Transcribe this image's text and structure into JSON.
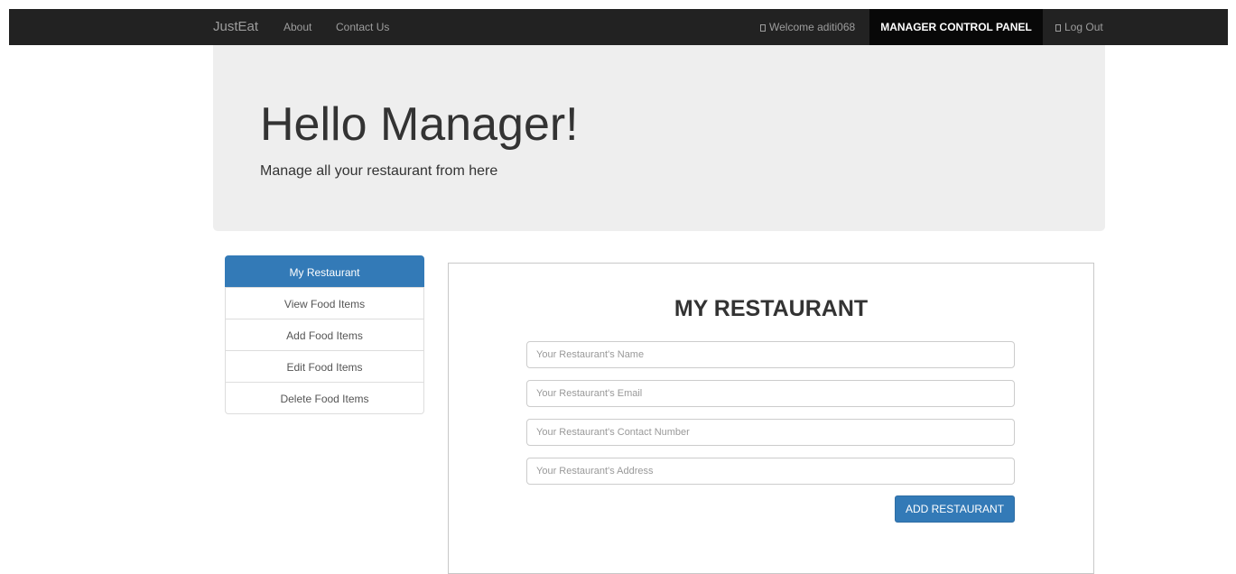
{
  "navbar": {
    "brand": "JustEat",
    "links": {
      "about": "About",
      "contact": "Contact Us"
    },
    "welcome": "Welcome aditi068",
    "control_panel": "MANAGER CONTROL PANEL",
    "logout": "Log Out"
  },
  "jumbotron": {
    "title": "Hello Manager!",
    "subtitle": "Manage all your restaurant from here"
  },
  "sidebar": {
    "items": [
      {
        "label": "My Restaurant",
        "active": true
      },
      {
        "label": "View Food Items"
      },
      {
        "label": "Add Food Items"
      },
      {
        "label": "Edit Food Items"
      },
      {
        "label": "Delete Food Items"
      }
    ]
  },
  "panel": {
    "title": "MY RESTAURANT",
    "fields": {
      "name": {
        "placeholder": "Your Restaurant's Name",
        "value": ""
      },
      "email": {
        "placeholder": "Your Restaurant's Email",
        "value": ""
      },
      "contact": {
        "placeholder": "Your Restaurant's Contact Number",
        "value": ""
      },
      "address": {
        "placeholder": "Your Restaurant's Address",
        "value": ""
      }
    },
    "submit_label": "ADD RESTAURANT"
  },
  "colors": {
    "navbar_bg": "#222222",
    "active_nav_bg": "#080808",
    "primary": "#337ab7",
    "jumbotron_bg": "#eeeeee"
  },
  "icons": {
    "welcome": "user-icon",
    "logout": "logout-icon"
  }
}
